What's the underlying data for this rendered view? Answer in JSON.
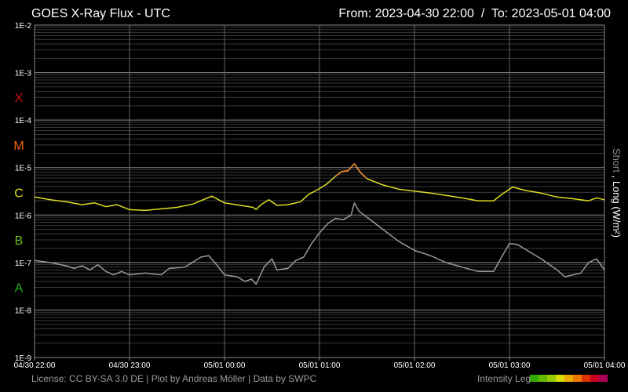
{
  "chart_data": {
    "type": "line",
    "title": "GOES X-Ray Flux - UTC",
    "range_label": "From: 2023-04-30 22:00  /  To: 2023-05-01 04:00",
    "ylabel_short": "Short",
    "ylabel_sep": " , ",
    "ylabel_long": "Long (W/m²)",
    "y_scale": "log",
    "ylim": [
      1e-09,
      0.01
    ],
    "y_ticks": [
      {
        "value": 0.01,
        "label": "1E-2"
      },
      {
        "value": 0.001,
        "label": "1E-3"
      },
      {
        "value": 0.0001,
        "label": "1E-4"
      },
      {
        "value": 1e-05,
        "label": "1E-5"
      },
      {
        "value": 1e-06,
        "label": "1E-6"
      },
      {
        "value": 1e-07,
        "label": "1E-7"
      },
      {
        "value": 1e-08,
        "label": "1E-8"
      },
      {
        "value": 1e-09,
        "label": "1E-9"
      }
    ],
    "flare_classes": [
      {
        "label": "X",
        "value": 0.0003,
        "color": "#cc1111"
      },
      {
        "label": "M",
        "value": 3e-05,
        "color": "#ee6611"
      },
      {
        "label": "C",
        "value": 3e-06,
        "color": "#dddd22"
      },
      {
        "label": "B",
        "value": 3e-07,
        "color": "#66bb22"
      },
      {
        "label": "A",
        "value": 3e-08,
        "color": "#22aa22"
      }
    ],
    "xlim": [
      "2023-04-30 22:00",
      "2023-05-01 04:00"
    ],
    "x_ticks": [
      {
        "value": "2023-04-30 22:00",
        "label": "04/30 22:00"
      },
      {
        "value": "2023-04-30 23:00",
        "label": "04/30 23:00"
      },
      {
        "value": "2023-05-01 00:00",
        "label": "05/01 00:00"
      },
      {
        "value": "2023-05-01 01:00",
        "label": "05/01 01:00"
      },
      {
        "value": "2023-05-01 02:00",
        "label": "05/01 02:00"
      },
      {
        "value": "2023-05-01 03:00",
        "label": "05/01 03:00"
      },
      {
        "value": "2023-05-01 04:00",
        "label": "05/01 04:00"
      }
    ],
    "grid": true,
    "series": [
      {
        "color": "#dddd22",
        "peak_color": "#ee8833",
        "points": [
          [
            "2023-04-30 22:00",
            2.4e-06
          ],
          [
            "2023-04-30 22:10",
            2.1e-06
          ],
          [
            "2023-04-30 22:20",
            1.9e-06
          ],
          [
            "2023-04-30 22:30",
            1.65e-06
          ],
          [
            "2023-04-30 22:38",
            1.8e-06
          ],
          [
            "2023-04-30 22:45",
            1.5e-06
          ],
          [
            "2023-04-30 22:52",
            1.65e-06
          ],
          [
            "2023-04-30 23:00",
            1.3e-06
          ],
          [
            "2023-04-30 23:10",
            1.25e-06
          ],
          [
            "2023-04-30 23:20",
            1.35e-06
          ],
          [
            "2023-04-30 23:30",
            1.45e-06
          ],
          [
            "2023-04-30 23:40",
            1.7e-06
          ],
          [
            "2023-04-30 23:48",
            2.2e-06
          ],
          [
            "2023-04-30 23:52",
            2.5e-06
          ],
          [
            "2023-05-01 00:00",
            1.8e-06
          ],
          [
            "2023-05-01 00:10",
            1.6e-06
          ],
          [
            "2023-05-01 00:18",
            1.45e-06
          ],
          [
            "2023-05-01 00:20",
            1.3e-06
          ],
          [
            "2023-05-01 00:23",
            1.65e-06
          ],
          [
            "2023-05-01 00:28",
            2.1e-06
          ],
          [
            "2023-05-01 00:33",
            1.6e-06
          ],
          [
            "2023-05-01 00:40",
            1.65e-06
          ],
          [
            "2023-05-01 00:48",
            1.9e-06
          ],
          [
            "2023-05-01 00:53",
            2.7e-06
          ],
          [
            "2023-05-01 01:00",
            3.6e-06
          ],
          [
            "2023-05-01 01:05",
            4.6e-06
          ],
          [
            "2023-05-01 01:10",
            6.5e-06
          ],
          [
            "2023-05-01 01:14",
            8.2e-06
          ],
          [
            "2023-05-01 01:18",
            8.6e-06
          ],
          [
            "2023-05-01 01:22",
            1.2e-05
          ],
          [
            "2023-05-01 01:26",
            7.8e-06
          ],
          [
            "2023-05-01 01:30",
            5.8e-06
          ],
          [
            "2023-05-01 01:40",
            4.3e-06
          ],
          [
            "2023-05-01 01:50",
            3.5e-06
          ],
          [
            "2023-05-01 02:00",
            3.2e-06
          ],
          [
            "2023-05-01 02:10",
            2.9e-06
          ],
          [
            "2023-05-01 02:20",
            2.6e-06
          ],
          [
            "2023-05-01 02:30",
            2.3e-06
          ],
          [
            "2023-05-01 02:40",
            2e-06
          ],
          [
            "2023-05-01 02:50",
            2e-06
          ],
          [
            "2023-05-01 02:55",
            2.7e-06
          ],
          [
            "2023-05-01 03:02",
            3.9e-06
          ],
          [
            "2023-05-01 03:10",
            3.3e-06
          ],
          [
            "2023-05-01 03:20",
            2.9e-06
          ],
          [
            "2023-05-01 03:30",
            2.4e-06
          ],
          [
            "2023-05-01 03:40",
            2.2e-06
          ],
          [
            "2023-05-01 03:50",
            2e-06
          ],
          [
            "2023-05-01 03:55",
            2.3e-06
          ],
          [
            "2023-05-01 04:00",
            2.1e-06
          ]
        ]
      },
      {
        "color": "#9a9a9a",
        "points": [
          [
            "2023-04-30 22:00",
            1.1e-07
          ],
          [
            "2023-04-30 22:10",
            1e-07
          ],
          [
            "2023-04-30 22:20",
            8.5e-08
          ],
          [
            "2023-04-30 22:25",
            7.5e-08
          ],
          [
            "2023-04-30 22:30",
            8.5e-08
          ],
          [
            "2023-04-30 22:35",
            7e-08
          ],
          [
            "2023-04-30 22:40",
            9e-08
          ],
          [
            "2023-04-30 22:45",
            6.5e-08
          ],
          [
            "2023-04-30 22:50",
            5.5e-08
          ],
          [
            "2023-04-30 22:55",
            6.5e-08
          ],
          [
            "2023-04-30 23:00",
            5.5e-08
          ],
          [
            "2023-04-30 23:10",
            6e-08
          ],
          [
            "2023-04-30 23:20",
            5.5e-08
          ],
          [
            "2023-04-30 23:25",
            7.5e-08
          ],
          [
            "2023-04-30 23:35",
            8e-08
          ],
          [
            "2023-04-30 23:45",
            1.3e-07
          ],
          [
            "2023-04-30 23:50",
            1.4e-07
          ],
          [
            "2023-04-30 23:55",
            9e-08
          ],
          [
            "2023-05-01 00:00",
            5.5e-08
          ],
          [
            "2023-05-01 00:08",
            5e-08
          ],
          [
            "2023-05-01 00:13",
            4e-08
          ],
          [
            "2023-05-01 00:17",
            4.5e-08
          ],
          [
            "2023-05-01 00:20",
            3.5e-08
          ],
          [
            "2023-05-01 00:25",
            8e-08
          ],
          [
            "2023-05-01 00:30",
            1.2e-07
          ],
          [
            "2023-05-01 00:33",
            7e-08
          ],
          [
            "2023-05-01 00:40",
            7.5e-08
          ],
          [
            "2023-05-01 00:45",
            1.1e-07
          ],
          [
            "2023-05-01 00:50",
            1.3e-07
          ],
          [
            "2023-05-01 00:55",
            2.5e-07
          ],
          [
            "2023-05-01 01:00",
            4.2e-07
          ],
          [
            "2023-05-01 01:05",
            6.5e-07
          ],
          [
            "2023-05-01 01:10",
            8.5e-07
          ],
          [
            "2023-05-01 01:15",
            8e-07
          ],
          [
            "2023-05-01 01:20",
            1e-06
          ],
          [
            "2023-05-01 01:22",
            1.8e-06
          ],
          [
            "2023-05-01 01:25",
            1.2e-06
          ],
          [
            "2023-05-01 01:30",
            9e-07
          ],
          [
            "2023-05-01 01:40",
            5e-07
          ],
          [
            "2023-05-01 01:50",
            2.8e-07
          ],
          [
            "2023-05-01 02:00",
            1.8e-07
          ],
          [
            "2023-05-01 02:10",
            1.4e-07
          ],
          [
            "2023-05-01 02:20",
            1e-07
          ],
          [
            "2023-05-01 02:30",
            8e-08
          ],
          [
            "2023-05-01 02:40",
            6.5e-08
          ],
          [
            "2023-05-01 02:50",
            6.5e-08
          ],
          [
            "2023-05-01 02:55",
            1.3e-07
          ],
          [
            "2023-05-01 03:00",
            2.5e-07
          ],
          [
            "2023-05-01 03:05",
            2.4e-07
          ],
          [
            "2023-05-01 03:10",
            1.9e-07
          ],
          [
            "2023-05-01 03:20",
            1.2e-07
          ],
          [
            "2023-05-01 03:30",
            7e-08
          ],
          [
            "2023-05-01 03:35",
            5e-08
          ],
          [
            "2023-05-01 03:40",
            5.5e-08
          ],
          [
            "2023-05-01 03:45",
            6e-08
          ],
          [
            "2023-05-01 03:50",
            1e-07
          ],
          [
            "2023-05-01 03:55",
            1.2e-07
          ],
          [
            "2023-05-01 04:00",
            7e-08
          ]
        ]
      }
    ],
    "footer": "License: CC BY-SA 3.0 DE | Plot by Andreas Möller | Data by SWPC",
    "intensity_label": "Intensity Leg",
    "intensity_colors": [
      "#33aa00",
      "#66bb00",
      "#99cc00",
      "#dddd00",
      "#eeaa00",
      "#ee7700",
      "#dd3300",
      "#cc0022",
      "#aa0055"
    ]
  }
}
